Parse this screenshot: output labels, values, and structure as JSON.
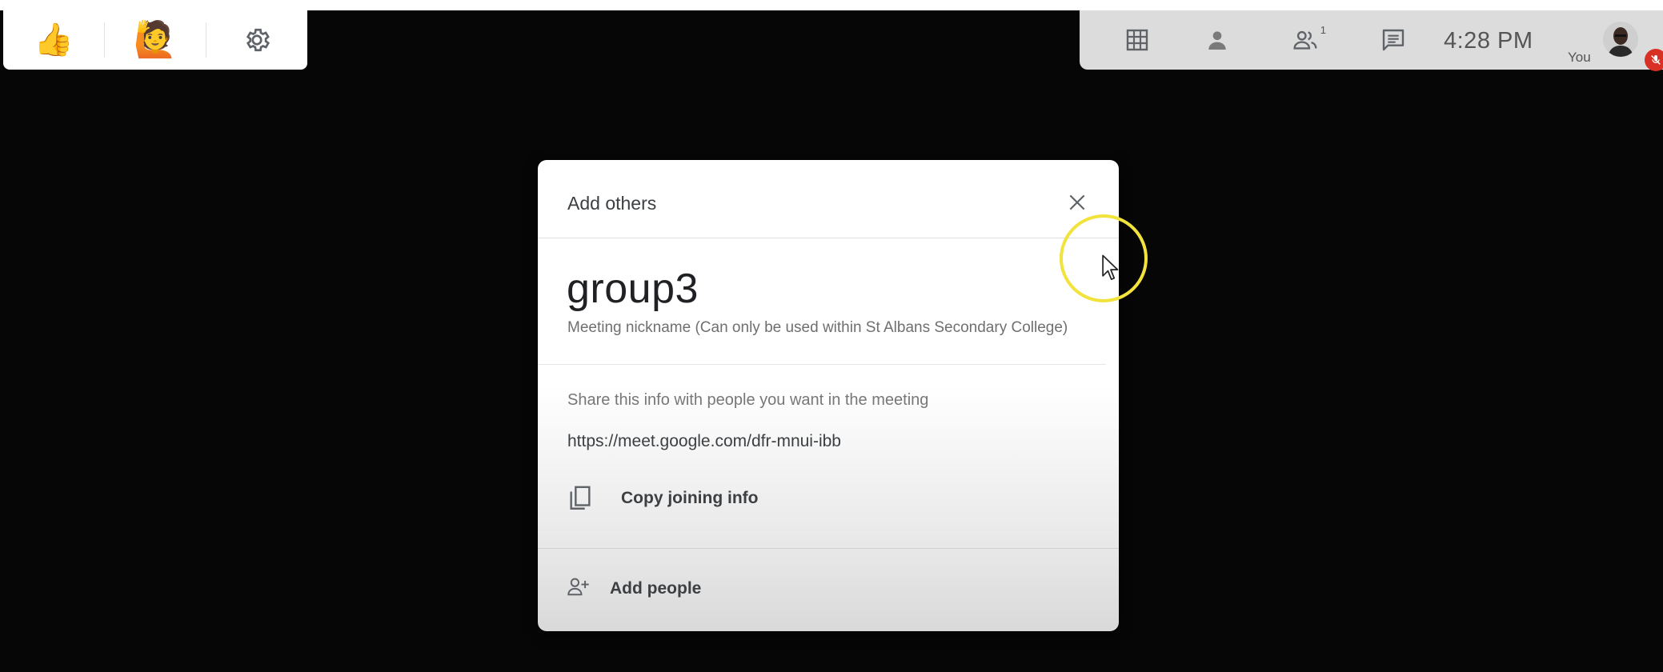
{
  "reactions_panel": {
    "items": [
      {
        "icon": "thumbs-up-emoji",
        "symbol": "👍"
      },
      {
        "icon": "raise-hand-emoji",
        "symbol": "🙋"
      },
      {
        "icon": "gear-icon"
      }
    ]
  },
  "controls_bar": {
    "clock": "4:28 PM",
    "participants_count": "1",
    "self_label": "You",
    "icons": [
      "grid-layout-icon",
      "person-icon",
      "people-icon",
      "chat-icon",
      "avatar",
      "mic-off-icon"
    ]
  },
  "dialog": {
    "title": "Add others",
    "nickname": "group3",
    "nickname_caption": "Meeting nickname (Can only be used within St Albans Secondary College)",
    "share_text": "Share this info with people you want in the meeting",
    "meeting_url": "https://meet.google.com/dfr-mnui-ibb",
    "copy_label": "Copy joining info",
    "add_people_label": "Add people"
  },
  "colors": {
    "background": "#060606",
    "dialog_bg": "#ffffff",
    "controls_bar_bg": "#dcdcdc",
    "cursor_highlight": "#f2e33c",
    "mic_off": "#d93025"
  }
}
